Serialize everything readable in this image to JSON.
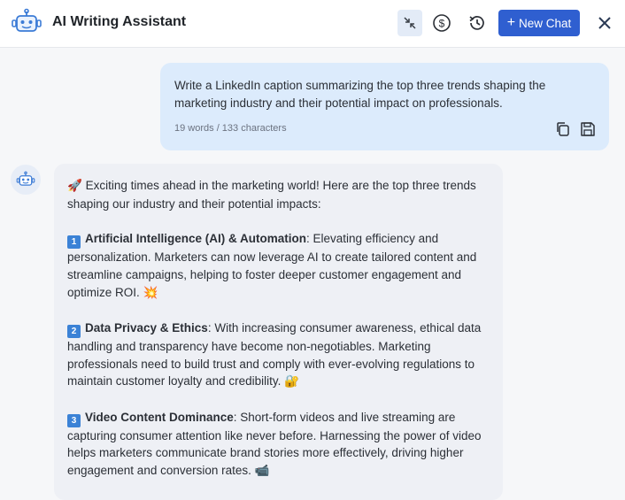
{
  "header": {
    "title": "AI Writing Assistant",
    "new_chat_label": "New Chat",
    "new_chat_icon": "+",
    "icons": [
      "robot-logo-icon",
      "minimize-arrows-icon",
      "dollar-circle-icon",
      "history-icon",
      "close-icon"
    ],
    "accent_color": "#2f5fd0"
  },
  "user_message": {
    "text": "Write a LinkedIn caption summarizing the top three trends shaping the marketing industry and their potential impact on professionals.",
    "meta": "19 words / 133 characters",
    "actions": [
      "copy-icon",
      "save-icon"
    ],
    "bubble_color": "#dcebfc"
  },
  "assistant_message": {
    "intro_emoji": "🚀",
    "intro": "Exciting times ahead in the marketing world! Here are the top three trends shaping our industry and their potential impacts:",
    "trends": [
      {
        "number": "1",
        "title": "Artificial Intelligence (AI) & Automation",
        "body": ": Elevating efficiency and personalization. Marketers can now leverage AI to create tailored content and streamline campaigns, helping to foster deeper customer engagement and optimize ROI.",
        "emoji": "💥"
      },
      {
        "number": "2",
        "title": "Data Privacy & Ethics",
        "body": ": With increasing consumer awareness, ethical data handling and transparency have become non-negotiables. Marketing professionals need to build trust and comply with ever-evolving regulations to maintain customer loyalty and credibility.",
        "emoji": "🔐"
      },
      {
        "number": "3",
        "title": "Video Content Dominance",
        "body": ": Short-form videos and live streaming are capturing consumer attention like never before. Harnessing the power of video helps marketers communicate brand stories more effectively, driving higher engagement and conversion rates.",
        "emoji": "📹"
      }
    ],
    "bubble_color": "#eef0f5"
  }
}
